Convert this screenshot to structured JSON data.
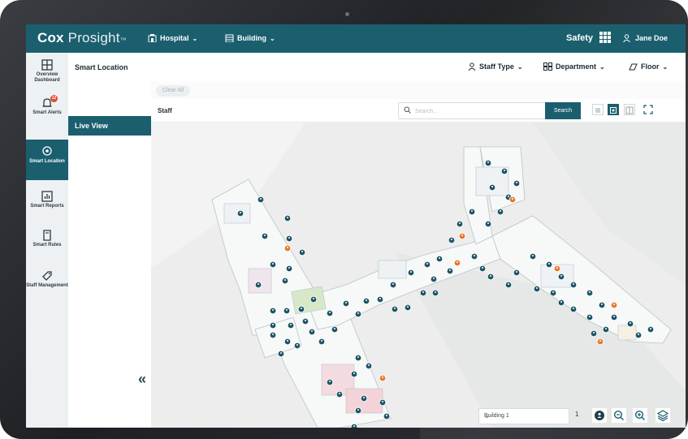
{
  "header": {
    "logo_brand": "Cox",
    "logo_product": "Prosight",
    "logo_mark": "™",
    "hospital_label": "Hospital",
    "building_label": "Building",
    "safety_label": "Safety",
    "user_name": "Jane Doe",
    "color": "#1b5f6f"
  },
  "rail": {
    "items": [
      {
        "label": "Overview Dashboard",
        "icon": "dashboard-icon"
      },
      {
        "label": "Smart Alerts",
        "icon": "bell-icon",
        "badge": "12"
      },
      {
        "label": "Smart Location",
        "icon": "location-pin-icon",
        "active": true
      },
      {
        "label": "Smart Reports",
        "icon": "report-chart-icon"
      },
      {
        "label": "Smart Rules",
        "icon": "rules-doc-icon"
      },
      {
        "label": "Staff Management",
        "icon": "tag-icon"
      }
    ]
  },
  "subnav": {
    "title": "Smart Location",
    "live_view": "Live View",
    "collapse_glyph": "«"
  },
  "filters": {
    "staff_type": "Staff Type",
    "department": "Department",
    "floor": "Floor"
  },
  "chipbar": {
    "clear_all": "Clear All"
  },
  "staffbar": {
    "label": "Staff",
    "search_placeholder": "Search...",
    "search_button": "Search"
  },
  "bottom": {
    "building_select": "Building 1",
    "floor_number": "1"
  },
  "colors": {
    "teal": "#1b5f6f",
    "pin_staff": "#1e5566",
    "pin_alert": "#e8772e",
    "badge": "#e24b3a"
  }
}
